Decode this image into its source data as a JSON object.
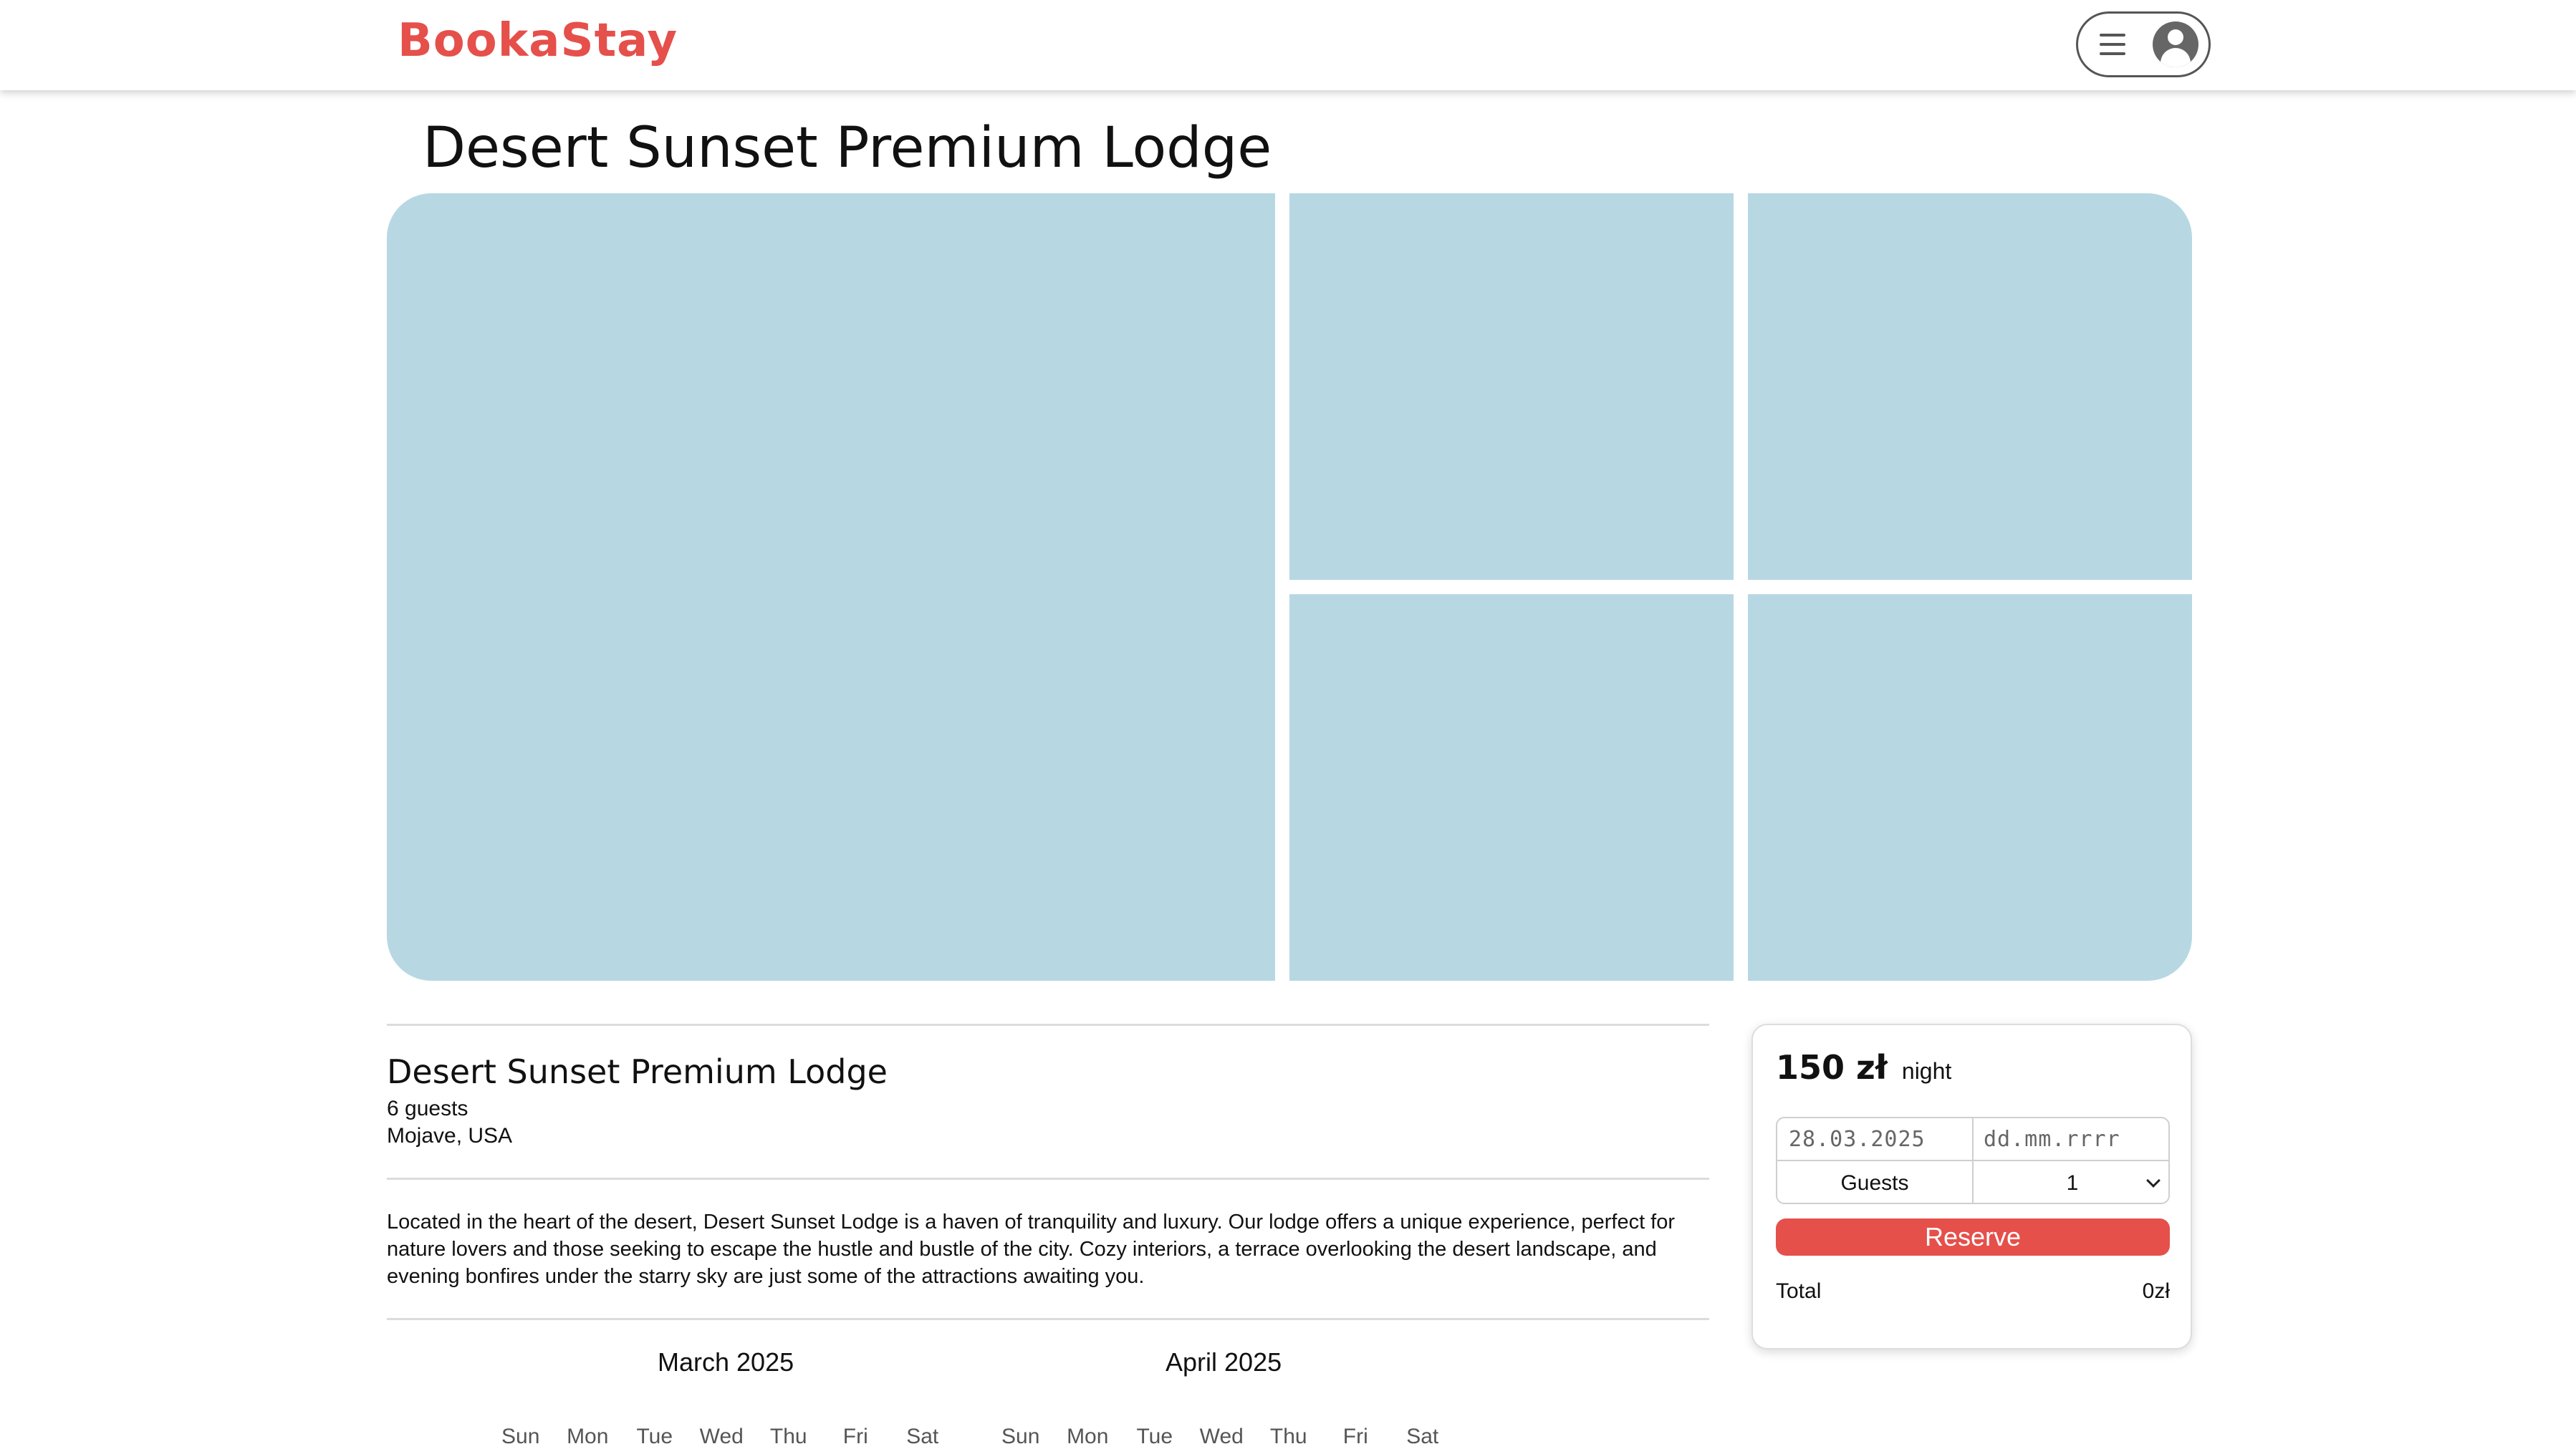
{
  "header": {
    "logo": "BookaStay",
    "menu_icon": "hamburger-menu-icon",
    "avatar_icon": "user-avatar-icon"
  },
  "listing": {
    "title": "Desert Sunset Premium Lodge",
    "details_title": "Desert Sunset Premium Lodge",
    "guests": "6 guests",
    "location": "Mojave, USA",
    "description": "Located in the heart of the desert, Desert Sunset Lodge is a haven of tranquility and luxury. Our lodge offers a unique experience, perfect for nature lovers and those seeking to escape the hustle and bustle of the city. Cozy interiors, a terrace overlooking the desert landscape, and evening bonfires under the starry sky are just some of the attractions awaiting you."
  },
  "calendar": {
    "months": [
      "March 2025",
      "April 2025"
    ],
    "weekdays": [
      "Sun",
      "Mon",
      "Tue",
      "Wed",
      "Thu",
      "Fri",
      "Sat"
    ]
  },
  "booking": {
    "price": "150 zł",
    "price_unit": "night",
    "checkin_value": "28.03.2025",
    "checkout_placeholder": "dd.mm.rrrr",
    "guests_label": "Guests",
    "guests_value": "1",
    "reserve_label": "Reserve",
    "total_label": "Total",
    "total_value": "0zł"
  },
  "colors": {
    "brand": "#e5504b",
    "photo_placeholder": "#b7d8e3"
  }
}
